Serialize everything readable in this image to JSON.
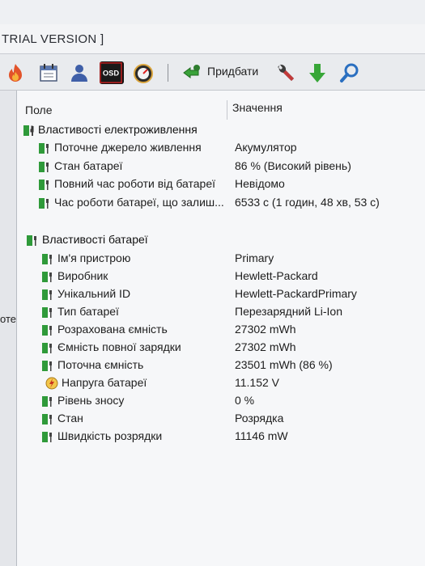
{
  "window": {
    "title": "TRIAL VERSION ]"
  },
  "toolbar": {
    "add_label": "Придбати",
    "icons": [
      "flame-icon",
      "calendar-icon",
      "user-icon",
      "osd-icon",
      "gauge-icon",
      "add-icon",
      "wrench-icon",
      "download-arrow-icon",
      "search-icon"
    ],
    "osd_text": "OSD"
  },
  "left_pane": {
    "label": "оте"
  },
  "table": {
    "headers": {
      "field": "Поле",
      "value": "Значення"
    },
    "groups": [
      {
        "title": "Властивості електроживлення",
        "rows": [
          {
            "field": "Поточне джерело живлення",
            "value": "Акумулятор"
          },
          {
            "field": "Стан батареї",
            "value": "86 % (Високий рівень)"
          },
          {
            "field": "Повний час роботи від батареї",
            "value": "Невідомо"
          },
          {
            "field": "Час роботи батареї, що залиш...",
            "value": "6533 с (1 годин, 48 хв, 53 с)"
          }
        ]
      },
      {
        "title": "Властивості батареї",
        "rows": [
          {
            "field": "Ім'я пристрою",
            "value": "Primary"
          },
          {
            "field": "Виробник",
            "value": "Hewlett-Packard"
          },
          {
            "field": "Унікальний ID",
            "value": "Hewlett-PackardPrimary"
          },
          {
            "field": "Тип батареї",
            "value": "Перезарядний Li-Ion"
          },
          {
            "field": "Розрахована ємність",
            "value": "27302 mWh"
          },
          {
            "field": "Ємність повної зарядки",
            "value": "27302 mWh"
          },
          {
            "field": "Поточна ємність",
            "value": "23501 mWh  (86 %)"
          },
          {
            "field": "Напруга батареї",
            "value": "11.152 V"
          },
          {
            "field": "Рівень зносу",
            "value": "0 %"
          },
          {
            "field": "Стан",
            "value": "Розрядка"
          },
          {
            "field": "Швидкість розрядки",
            "value": "11146 mW"
          }
        ]
      }
    ]
  },
  "colors": {
    "battery_green": "#2f9a3a",
    "header_bg": "#f6f7f9",
    "accent_green": "#3aa23a",
    "search_blue": "#2a6fc0"
  }
}
